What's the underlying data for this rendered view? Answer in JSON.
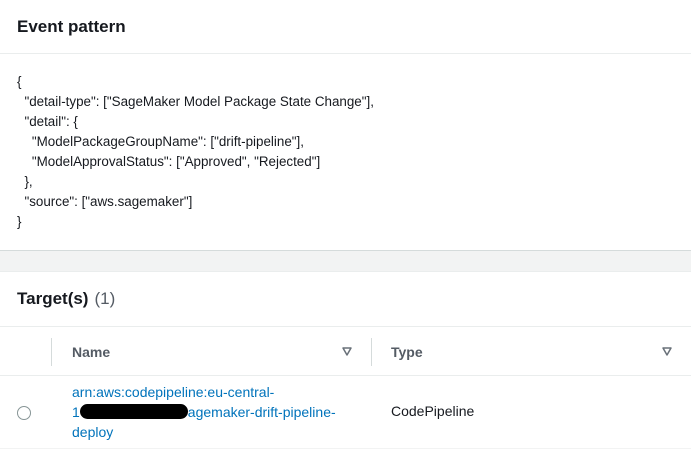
{
  "event_pattern": {
    "title": "Event pattern",
    "code": "{\n  \"detail-type\": [\"SageMaker Model Package State Change\"],\n  \"detail\": {\n    \"ModelPackageGroupName\": [\"drift-pipeline\"],\n    \"ModelApprovalStatus\": [\"Approved\", \"Rejected\"]\n  },\n  \"source\": [\"aws.sagemaker\"]\n}"
  },
  "targets": {
    "title": "Target(s)",
    "count": "(1)",
    "columns": {
      "name": "Name",
      "type": "Type"
    },
    "rows": [
      {
        "name_line1": "arn:aws:codepipeline:eu-central-",
        "name_line2_prefix": "1",
        "name_line2_suffix": "agemaker-drift-pipeline-",
        "name_line3": "deploy",
        "type": "CodePipeline"
      }
    ]
  },
  "icons": {
    "sort": "caret-down-icon",
    "select": "radio-icon"
  },
  "colors": {
    "link": "#0073bb",
    "heading": "#16191f",
    "muted": "#545b64"
  }
}
